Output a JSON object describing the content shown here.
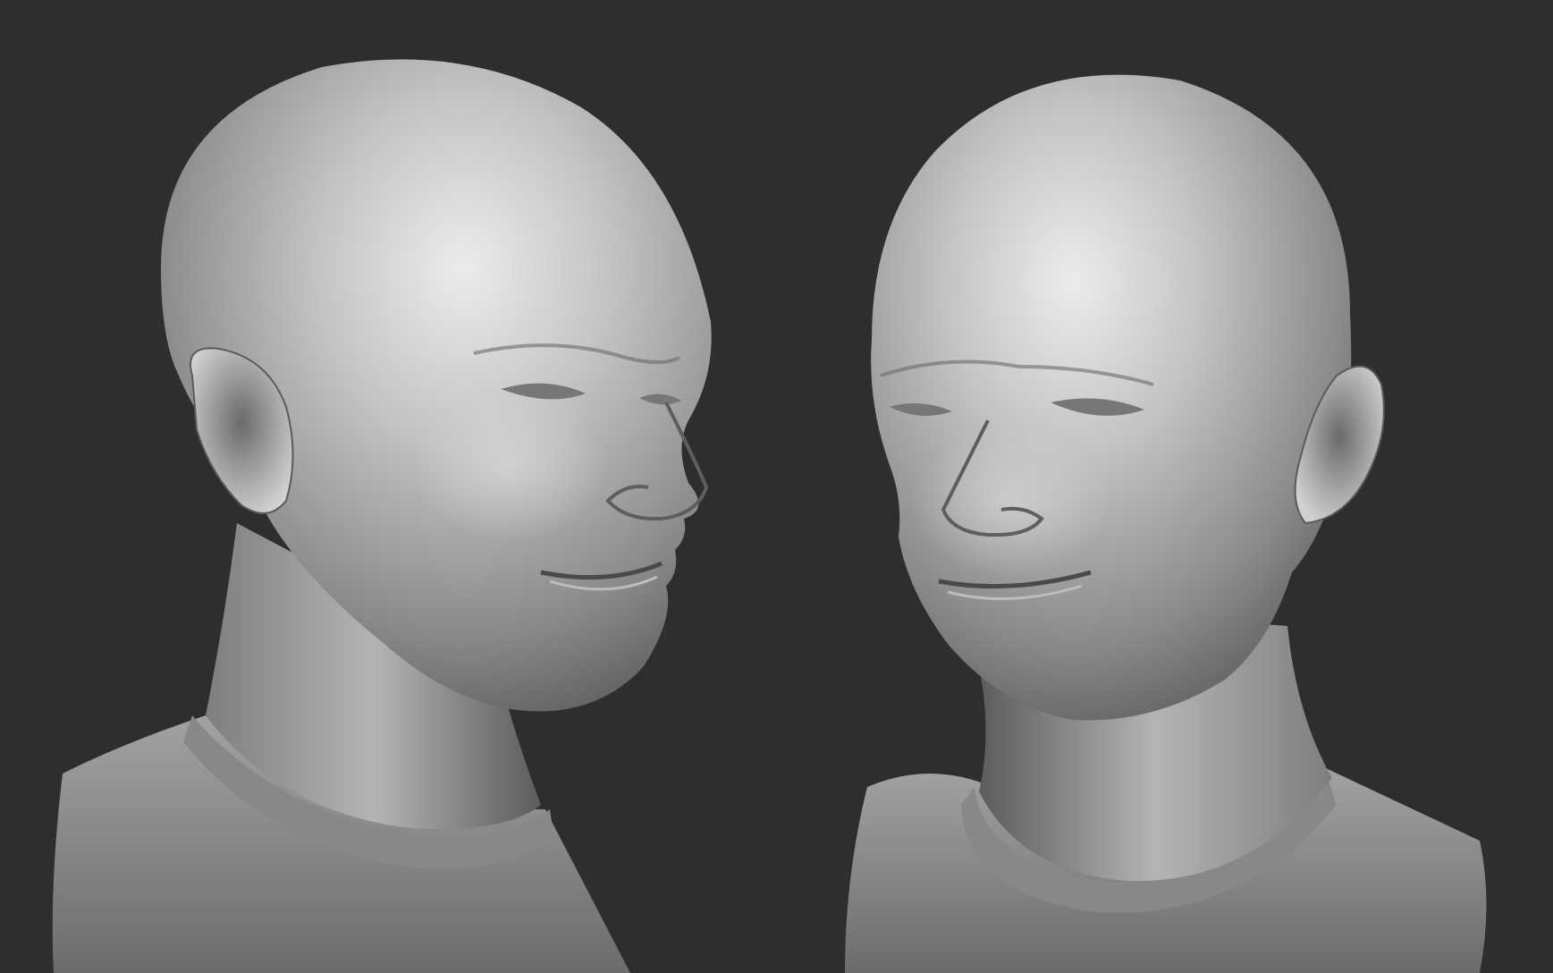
{
  "scene": {
    "background_color": "#2e2e2e",
    "material_color": "#9a9a9a",
    "highlight_color": "#e6e6e6",
    "shadow_color": "#3a3a3a",
    "subjects": [
      {
        "name": "bust-three-quarter-right",
        "icon": "sculpted-head-bust-icon"
      },
      {
        "name": "bust-three-quarter-left",
        "icon": "sculpted-head-bust-icon"
      }
    ]
  }
}
